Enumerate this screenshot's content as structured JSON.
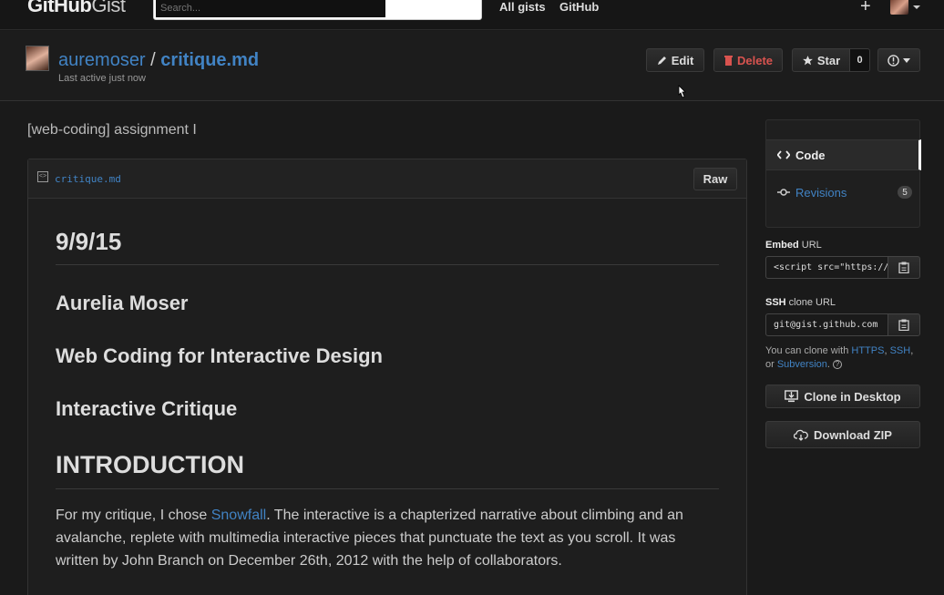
{
  "nav": {
    "logo_bold": "GitHub",
    "logo_light": "Gist",
    "search_placeholder": "Search...",
    "links": [
      "All gists",
      "GitHub"
    ],
    "plus": "+"
  },
  "header": {
    "owner": "auremoser",
    "separator": "/",
    "filename": "critique.md",
    "last_active": "Last active just now",
    "edit_label": "Edit",
    "delete_label": "Delete",
    "star_label": "Star",
    "star_count": "0"
  },
  "description": "[web-coding] assignment I",
  "file": {
    "name": "critique.md",
    "raw_label": "Raw",
    "h_date": "9/9/15",
    "h_author": "Aurelia Moser",
    "h_course": "Web Coding for Interactive Design",
    "h_assignment": "Interactive Critique",
    "h_intro": "INTRODUCTION",
    "p1_before": "For my critique, I chose ",
    "p1_link": "Snowfall",
    "p1_after": ". The interactive is a chapterized narrative about climbing and an avalanche, replete with multimedia interactive pieces that punctuate the text as you scroll. It was written by John Branch on December 26th, 2012 with the help of collaborators."
  },
  "sidebar": {
    "code_label": "Code",
    "revisions_label": "Revisions",
    "revisions_count": "5",
    "embed_bold": "Embed",
    "embed_rest": " URL",
    "embed_value": "<script src=\"https://gist.github.com",
    "ssh_bold": "SSH",
    "ssh_rest": " clone URL",
    "ssh_value": "git@gist.github.com",
    "clone_text_1": "You can clone with ",
    "clone_https": "HTTPS",
    "clone_comma": ", ",
    "clone_ssh": "SSH",
    "clone_text_2": ",",
    "clone_text_3": "or ",
    "clone_svn": "Subversion",
    "clone_period": ".",
    "clone_desktop_label": "Clone in Desktop",
    "download_label": "Download ZIP"
  },
  "colors": {
    "link": "#4183c4",
    "danger": "#d9534f",
    "background": "#1a1a1a"
  }
}
